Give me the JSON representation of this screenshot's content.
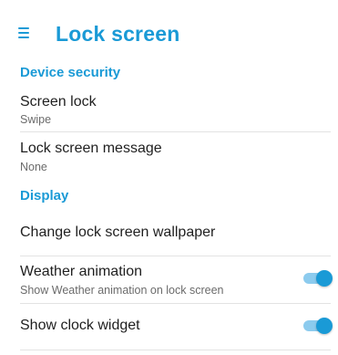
{
  "app_bar": {
    "menu_icon": "hamburger-menu-icon",
    "title": "Lock screen"
  },
  "colors": {
    "accent": "#1a9ad6",
    "switch_track_on": "#8ccbee",
    "divider": "#e3e3e3"
  },
  "sections": {
    "device_security": {
      "header": "Device security",
      "screen_lock": {
        "title": "Screen lock",
        "summary": "Swipe"
      },
      "lock_screen_message": {
        "title": "Lock screen message",
        "summary": "None"
      }
    },
    "display": {
      "header": "Display",
      "change_wallpaper": {
        "title": "Change lock screen wallpaper"
      },
      "weather_animation": {
        "title": "Weather animation",
        "summary": "Show Weather animation on lock screen",
        "enabled": true
      },
      "show_clock_widget": {
        "title": "Show clock widget",
        "enabled": true
      }
    }
  }
}
